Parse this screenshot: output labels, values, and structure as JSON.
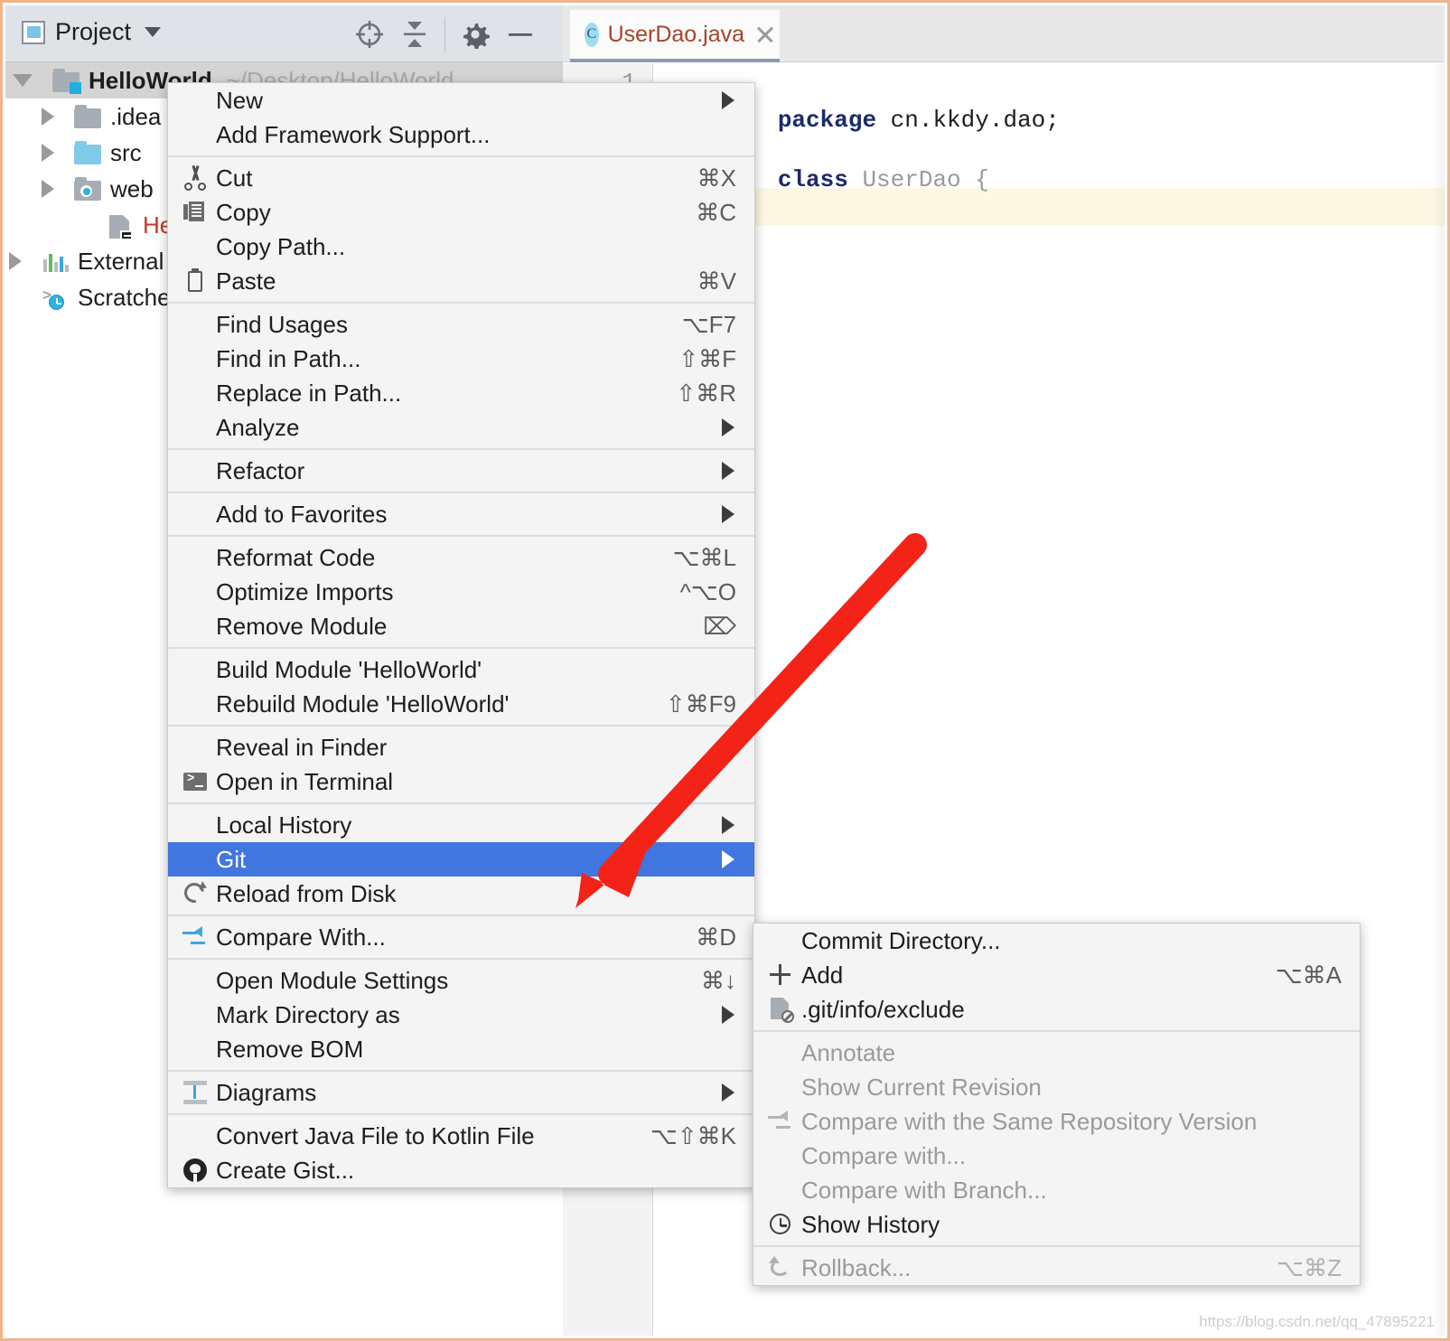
{
  "project_panel": {
    "title": "Project",
    "dropdown_icon": "chevron-down-icon",
    "toolbar_icons": [
      "locate-target-icon",
      "collapse-all-icon",
      "gear-icon",
      "minimize-icon"
    ],
    "tree": [
      {
        "label": "HelloWorld",
        "path": "~/Desktop/HelloWorld",
        "icon": "module-folder-icon",
        "indent": 0,
        "expanded": true,
        "selected": true,
        "bold": true
      },
      {
        "label": ".idea",
        "icon": "folder-icon",
        "indent": 1,
        "expanded": false
      },
      {
        "label": "src",
        "icon": "source-folder-icon",
        "indent": 1,
        "expanded": false
      },
      {
        "label": "web",
        "icon": "web-folder-icon",
        "indent": 1,
        "expanded": false
      },
      {
        "label": "HelloW",
        "icon": "iml-file-icon",
        "indent": 2,
        "red": true
      },
      {
        "label": "External",
        "icon": "libraries-icon",
        "indent": 0,
        "expanded": false
      },
      {
        "label": "Scratche",
        "icon": "scratches-icon",
        "indent": 0
      }
    ]
  },
  "editor": {
    "tab": {
      "label": "UserDao.java",
      "class_icon": "C",
      "close_icon": "close-icon"
    },
    "line_number": "1",
    "code": [
      {
        "tokens": [
          {
            "t": "package",
            "c": "kw"
          },
          {
            "t": " cn.kkdy.dao;",
            "c": "plain"
          }
        ]
      },
      {
        "tokens": [
          {
            "t": "class",
            "c": "kw"
          },
          {
            "t": " UserDao {",
            "c": "ident"
          }
        ]
      }
    ]
  },
  "context_menu": {
    "sections": [
      {
        "items": [
          {
            "label": "New",
            "submenu": true
          },
          {
            "label": "Add Framework Support..."
          }
        ]
      },
      {
        "items": [
          {
            "label": "Cut",
            "shortcut": "⌘X",
            "icon": "cut-icon"
          },
          {
            "label": "Copy",
            "shortcut": "⌘C",
            "icon": "copy-icon"
          },
          {
            "label": "Copy Path..."
          },
          {
            "label": "Paste",
            "shortcut": "⌘V",
            "icon": "paste-icon"
          }
        ]
      },
      {
        "items": [
          {
            "label": "Find Usages",
            "shortcut": "⌥F7"
          },
          {
            "label": "Find in Path...",
            "shortcut": "⇧⌘F"
          },
          {
            "label": "Replace in Path...",
            "shortcut": "⇧⌘R"
          },
          {
            "label": "Analyze",
            "submenu": true
          }
        ]
      },
      {
        "items": [
          {
            "label": "Refactor",
            "submenu": true
          }
        ]
      },
      {
        "items": [
          {
            "label": "Add to Favorites",
            "submenu": true
          }
        ]
      },
      {
        "items": [
          {
            "label": "Reformat Code",
            "shortcut": "⌥⌘L"
          },
          {
            "label": "Optimize Imports",
            "shortcut": "^⌥O"
          },
          {
            "label": "Remove Module",
            "shortcut": "⌦"
          }
        ]
      },
      {
        "items": [
          {
            "label": "Build Module 'HelloWorld'"
          },
          {
            "label": "Rebuild Module 'HelloWorld'",
            "shortcut": "⇧⌘F9"
          }
        ]
      },
      {
        "items": [
          {
            "label": "Reveal in Finder"
          },
          {
            "label": "Open in Terminal",
            "icon": "terminal-icon"
          }
        ]
      },
      {
        "items": [
          {
            "label": "Local History",
            "submenu": true
          },
          {
            "label": "Git",
            "submenu": true,
            "selected": true
          },
          {
            "label": "Reload from Disk",
            "icon": "reload-icon"
          }
        ]
      },
      {
        "items": [
          {
            "label": "Compare With...",
            "shortcut": "⌘D",
            "icon": "compare-icon"
          }
        ]
      },
      {
        "items": [
          {
            "label": "Open Module Settings",
            "shortcut": "⌘↓"
          },
          {
            "label": "Mark Directory as",
            "submenu": true
          },
          {
            "label": "Remove BOM"
          }
        ]
      },
      {
        "items": [
          {
            "label": "Diagrams",
            "submenu": true,
            "icon": "diagram-icon"
          }
        ]
      },
      {
        "items": [
          {
            "label": "Convert Java File to Kotlin File",
            "shortcut": "⌥⇧⌘K"
          },
          {
            "label": "Create Gist...",
            "icon": "github-icon"
          }
        ]
      }
    ]
  },
  "git_submenu": {
    "sections": [
      {
        "items": [
          {
            "label": "Commit Directory..."
          },
          {
            "label": "Add",
            "shortcut": "⌥⌘A",
            "icon": "plus-icon"
          },
          {
            "label": ".git/info/exclude",
            "icon": "exclude-file-icon"
          }
        ]
      },
      {
        "items": [
          {
            "label": "Annotate",
            "disabled": true
          },
          {
            "label": "Show Current Revision",
            "disabled": true
          },
          {
            "label": "Compare with the Same Repository Version",
            "disabled": true,
            "icon": "compare-icon-gray"
          },
          {
            "label": "Compare with...",
            "disabled": true
          },
          {
            "label": "Compare with Branch...",
            "disabled": true
          },
          {
            "label": "Show History",
            "icon": "clock-icon"
          }
        ]
      },
      {
        "items": [
          {
            "label": "Rollback...",
            "shortcut": "⌥⌘Z",
            "disabled": true,
            "icon": "rollback-icon"
          }
        ]
      }
    ]
  },
  "annotation": {
    "arrow_color": "#f42318",
    "icon": "red-arrow-annotation"
  },
  "watermark": {
    "text": "https://blog.csdn.net/qq_47895221"
  },
  "colors": {
    "menu_bg": "#f4f4f4",
    "selection_blue": "#4176e0",
    "toolbar_bg": "#dfe3e8",
    "caret_line": "#fcf8e3",
    "tab_text": "#a6432c",
    "window_border": "#f0b48a"
  }
}
